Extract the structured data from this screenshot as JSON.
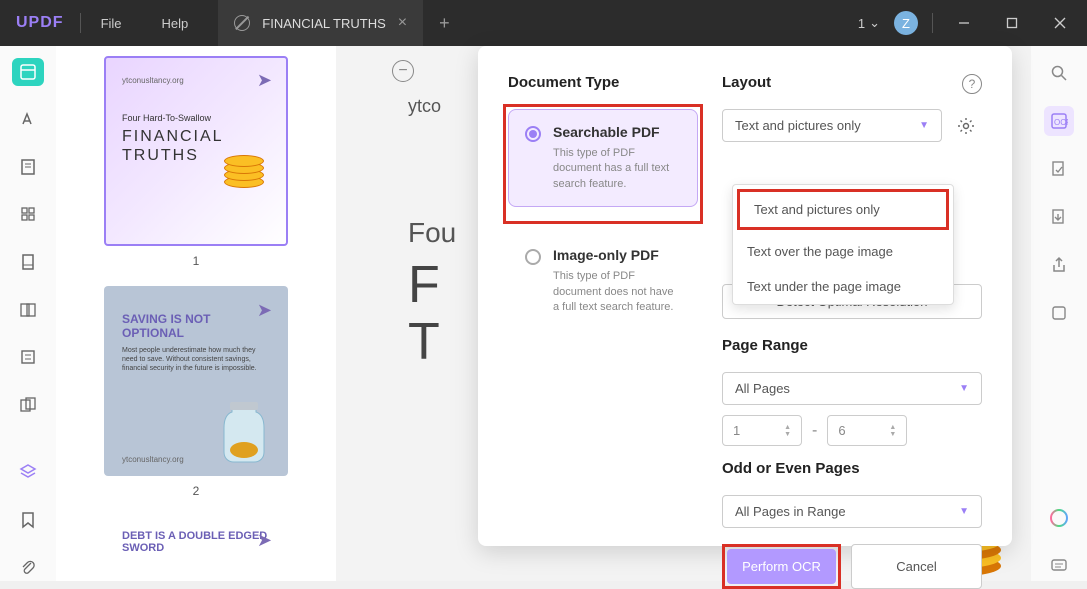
{
  "titlebar": {
    "logo": "UPDF",
    "menu": {
      "file": "File",
      "help": "Help"
    },
    "tab": {
      "title": "FINANCIAL TRUTHS"
    },
    "tab_count": "1",
    "avatar_letter": "Z"
  },
  "thumbnails": [
    {
      "number": "1",
      "url": "ytconusltancy.org",
      "subtitle": "Four Hard-To-Swallow",
      "title_line1": "FINANCIAL",
      "title_line2": "TRUTHS"
    },
    {
      "number": "2",
      "title": "SAVING IS NOT OPTIONAL",
      "text": "Most people underestimate how much they need to save. Without consistent savings, financial security in the future is impossible.",
      "url": "ytconusltancy.org"
    },
    {
      "title": "DEBT IS A DOUBLE EDGED SWORD"
    }
  ],
  "preview": {
    "url_fragment": "ytco",
    "subtitle_fragment": "Fou",
    "title_fragment_1": "F",
    "title_fragment_2": "T"
  },
  "dialog": {
    "doc_type_header": "Document Type",
    "layout_header": "Layout",
    "options": {
      "searchable": {
        "label": "Searchable PDF",
        "desc": "This type of PDF document has a full text search feature."
      },
      "image_only": {
        "label": "Image-only PDF",
        "desc": "This type of PDF document does not have a full text search feature."
      }
    },
    "layout_select": "Text and pictures only",
    "layout_dropdown": [
      "Text and pictures only",
      "Text over the page image",
      "Text under the page image"
    ],
    "detect_btn": "Detect Optimal Resolution",
    "page_range_header": "Page Range",
    "page_range_select": "All Pages",
    "range_from": "1",
    "range_to": "6",
    "odd_even_header": "Odd or Even Pages",
    "odd_even_select": "All Pages in Range",
    "perform_btn": "Perform OCR",
    "cancel_btn": "Cancel"
  }
}
